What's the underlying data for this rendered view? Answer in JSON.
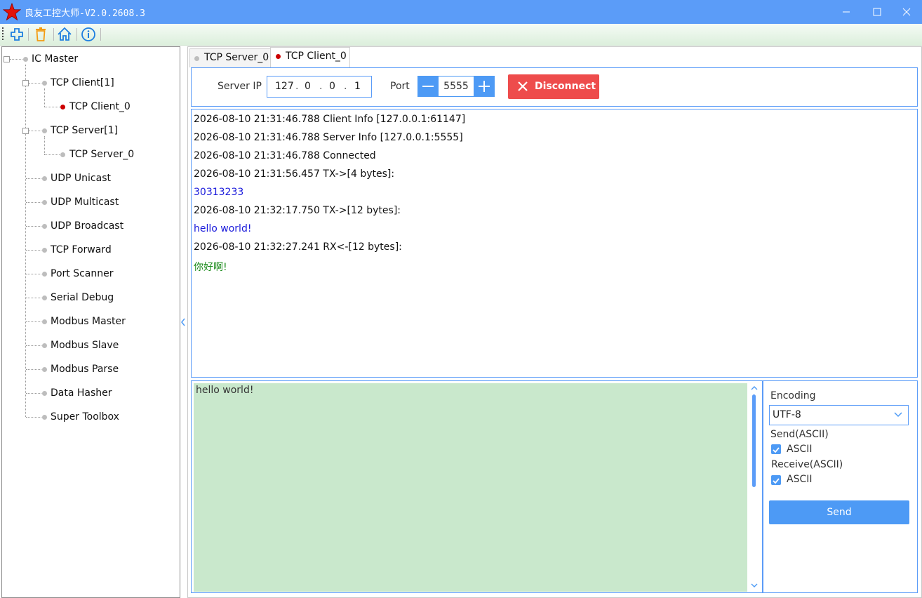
{
  "window": {
    "title": "良友工控大师-V2.0.2608.3",
    "accent": "#5b9cf8"
  },
  "toolbar": {
    "icons": [
      "add-icon",
      "delete-icon",
      "home-icon",
      "info-icon"
    ]
  },
  "tree": {
    "root": "IC Master",
    "tcp_client_group": "TCP Client[1]",
    "tcp_client_item": "TCP Client_0",
    "tcp_server_group": "TCP Server[1]",
    "tcp_server_item": "TCP Server_0",
    "items": [
      "UDP Unicast",
      "UDP Multicast",
      "UDP Broadcast",
      "TCP Forward",
      "Port Scanner",
      "Serial Debug",
      "Modbus Master",
      "Modbus Slave",
      "Modbus Parse",
      "Data Hasher",
      "Super Toolbox"
    ]
  },
  "tabs": [
    {
      "label": "TCP Server_0",
      "status": "idle"
    },
    {
      "label": "TCP Client_0",
      "status": "active"
    }
  ],
  "connection": {
    "server_ip_label": "Server IP",
    "ip": [
      "127",
      "0",
      "0",
      "1"
    ],
    "port_label": "Port",
    "port": "5555",
    "disconnect_label": "Disconnect",
    "disconnect_color": "#ee4c4c"
  },
  "log": [
    {
      "text": "2026-08-10 21:31:46.788 Client Info [127.0.0.1:61147]",
      "color": "#111111"
    },
    {
      "text": "2026-08-10 21:31:46.788 Server Info [127.0.0.1:5555]",
      "color": "#111111"
    },
    {
      "text": "2026-08-10 21:31:46.788 Connected",
      "color": "#111111"
    },
    {
      "text": "2026-08-10 21:31:56.457 TX->[4 bytes]:",
      "color": "#111111"
    },
    {
      "text": "30313233",
      "color": "#1a1adb"
    },
    {
      "text": "2026-08-10 21:32:17.750 TX->[12 bytes]:",
      "color": "#111111"
    },
    {
      "text": "hello world!",
      "color": "#1a1adb"
    },
    {
      "text": "2026-08-10 21:32:27.241 RX<-[12 bytes]:",
      "color": "#111111"
    },
    {
      "text": "你好啊!",
      "color": "#1a8a1a"
    }
  ],
  "send": {
    "text": "hello world!",
    "encoding_label": "Encoding",
    "encoding_value": "UTF-8",
    "send_mode_label": "Send(ASCII)",
    "send_ascii_label": "ASCII",
    "send_ascii_checked": true,
    "receive_mode_label": "Receive(ASCII)",
    "receive_ascii_label": "ASCII",
    "receive_ascii_checked": true,
    "send_button_label": "Send"
  }
}
